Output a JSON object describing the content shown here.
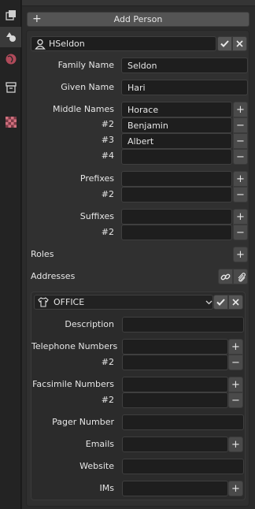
{
  "toolbar": {
    "add_person_label": "Add Person"
  },
  "person": {
    "name_value": "HSeldon",
    "family_name": {
      "label": "Family Name",
      "value": "Seldon"
    },
    "given_name": {
      "label": "Given Name",
      "value": "Hari"
    },
    "middle_names": {
      "label": "Middle Names",
      "rows": [
        {
          "label": "Middle Names",
          "value": "Horace"
        },
        {
          "label": "#2",
          "value": "Benjamin"
        },
        {
          "label": "#3",
          "value": "Albert"
        },
        {
          "label": "#4",
          "value": ""
        }
      ]
    },
    "prefixes": {
      "rows": [
        {
          "label": "Prefixes",
          "value": ""
        },
        {
          "label": "#2",
          "value": ""
        }
      ]
    },
    "suffixes": {
      "rows": [
        {
          "label": "Suffixes",
          "value": ""
        },
        {
          "label": "#2",
          "value": ""
        }
      ]
    },
    "roles_label": "Roles",
    "addresses_label": "Addresses"
  },
  "address": {
    "type_value": "OFFICE",
    "description_label": "Description",
    "telephone": {
      "rows": [
        {
          "label": "Telephone Numbers",
          "value": ""
        },
        {
          "label": "#2",
          "value": ""
        }
      ]
    },
    "facsimile": {
      "rows": [
        {
          "label": "Facsimile Numbers",
          "value": ""
        },
        {
          "label": "#2",
          "value": ""
        }
      ]
    },
    "pager_label": "Pager Number",
    "emails_label": "Emails",
    "website_label": "Website",
    "ims_label": "IMs"
  },
  "colors": {
    "accent_tab": "#b04a5a",
    "panel_bg": "#303030",
    "field_bg": "#1e1e1e"
  },
  "icons": {
    "rail": [
      "render-layers-icon",
      "shapes-properties-icon",
      "world-icon",
      "storage-box-icon",
      "checker-texture-icon"
    ],
    "person": "user-icon",
    "address_type": "shirt-icon",
    "links": [
      "link-icon",
      "paperclip-icon"
    ]
  }
}
